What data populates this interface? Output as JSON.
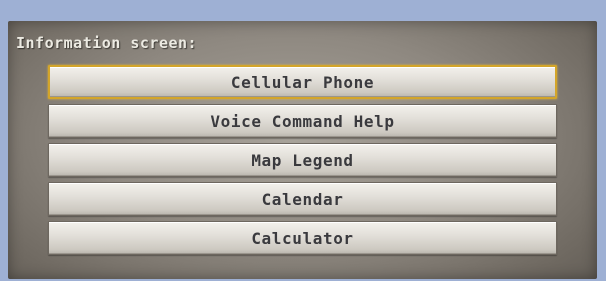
{
  "screen": {
    "title": "Information screen:"
  },
  "menu": {
    "items": [
      {
        "label": "Cellular Phone",
        "selected": true
      },
      {
        "label": "Voice Command Help",
        "selected": false
      },
      {
        "label": "Map Legend",
        "selected": false
      },
      {
        "label": "Calendar",
        "selected": false
      },
      {
        "label": "Calculator",
        "selected": false
      }
    ]
  },
  "colors": {
    "frame": "#9eb0d4",
    "selection_border": "#d3a52a",
    "button_text": "#3a3a3e",
    "title_text": "#eceae2"
  }
}
